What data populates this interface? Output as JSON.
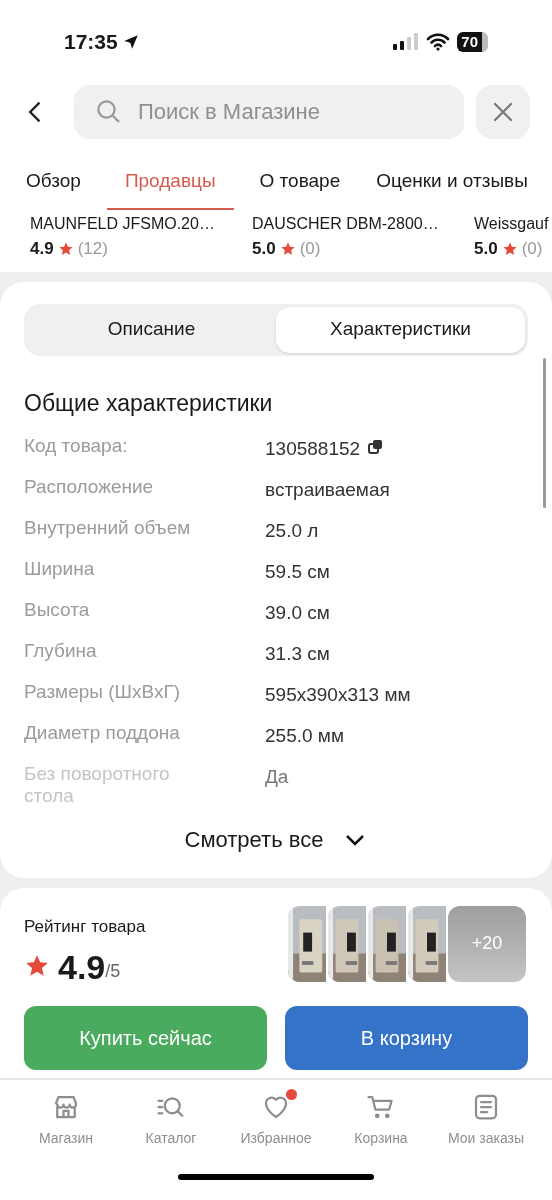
{
  "status_bar": {
    "time": "17:35",
    "battery": "70"
  },
  "search": {
    "placeholder": "Поиск в Магазине"
  },
  "tabs": [
    {
      "label": "Обзор",
      "selected": false
    },
    {
      "label": "Продавцы",
      "selected": true
    },
    {
      "label": "О товаре",
      "selected": false
    },
    {
      "label": "Оценки и отзывы",
      "selected": false
    }
  ],
  "sellers": [
    {
      "name": "MAUNFELD JFSMO.20…",
      "rating": "4.9",
      "count": "(12)"
    },
    {
      "name": "DAUSCHER DBM-2800…",
      "rating": "5.0",
      "count": "(0)"
    },
    {
      "name": "Weissgauf",
      "rating": "5.0",
      "count": "(0)"
    }
  ],
  "segments": [
    {
      "label": "Описание",
      "selected": false
    },
    {
      "label": "Характеристики",
      "selected": true
    }
  ],
  "specs": {
    "title": "Общие характеристики",
    "rows": [
      {
        "label": "Код товара:",
        "value": "130588152",
        "copyable": true,
        "faded": false
      },
      {
        "label": "Расположение",
        "value": "встраиваемая",
        "copyable": false,
        "faded": false
      },
      {
        "label": "Внутренний объем",
        "value": "25.0 л",
        "copyable": false,
        "faded": false
      },
      {
        "label": "Ширина",
        "value": "59.5 см",
        "copyable": false,
        "faded": false
      },
      {
        "label": "Высота",
        "value": "39.0 см",
        "copyable": false,
        "faded": false
      },
      {
        "label": "Глубина",
        "value": "31.3 см",
        "copyable": false,
        "faded": false
      },
      {
        "label": "Размеры (ШхВхГ)",
        "value": "595x390x313 мм",
        "copyable": false,
        "faded": false
      },
      {
        "label": "Диаметр поддона",
        "value": "255.0 мм",
        "copyable": false,
        "faded": false
      },
      {
        "label": "Без поворотного стола",
        "value": "Да",
        "copyable": false,
        "faded": true
      }
    ],
    "show_all": "Смотреть все"
  },
  "rating": {
    "title": "Рейтинг товара",
    "value": "4.9",
    "scale": "/5",
    "more": "+20"
  },
  "actions": [
    {
      "label": "Купить сейчас",
      "kind": "buy"
    },
    {
      "label": "В корзину",
      "kind": "cart"
    }
  ],
  "nav": [
    {
      "label": "Магазин",
      "kind": "store",
      "badge": false
    },
    {
      "label": "Каталог",
      "kind": "catalog",
      "badge": false
    },
    {
      "label": "Избранное",
      "kind": "heart",
      "badge": true
    },
    {
      "label": "Корзина",
      "kind": "cart",
      "badge": false
    },
    {
      "label": "Мои заказы",
      "kind": "orders",
      "badge": false
    }
  ]
}
